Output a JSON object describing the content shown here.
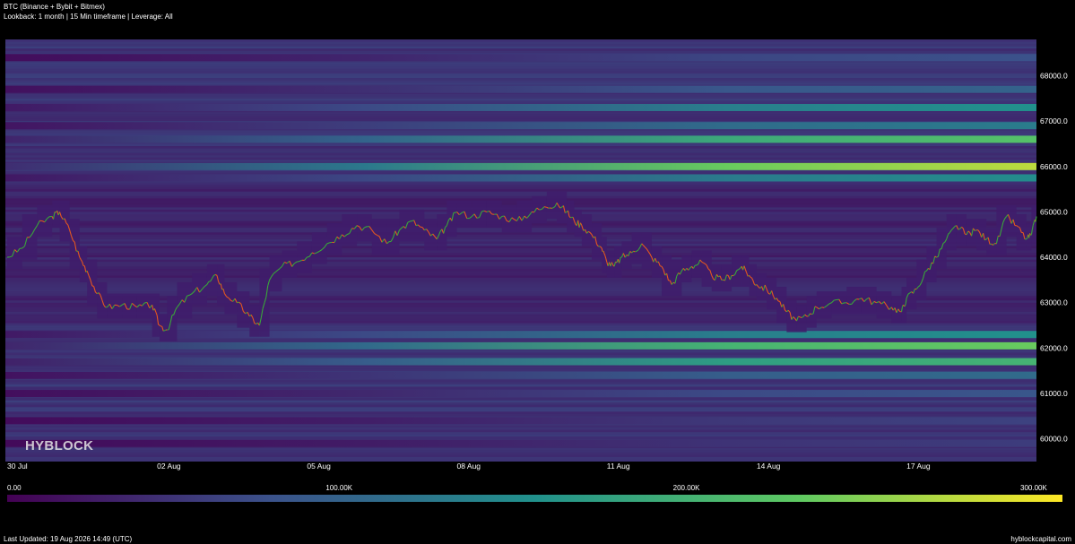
{
  "header": {
    "title": "BTC (Binance + Bybit + Bitmex)",
    "subtitle": "Lookback: 1 month | 15 Min timeframe | Leverage: All"
  },
  "watermark": "HYBLOCK",
  "footer": {
    "last_updated": "Last Updated: 19 Aug 2026 14:49 (UTC)",
    "site": "hyblockcapital.com"
  },
  "colors": {
    "background": "#000000",
    "price_up": "#3aa63a",
    "price_down": "#e4571f",
    "colormap": [
      "#440154",
      "#3b528b",
      "#21918c",
      "#5ec962",
      "#fde725"
    ]
  },
  "chart_data": {
    "type": "heatmap",
    "overlay": "price_line",
    "title": "BTC (Binance + Bybit + Bitmex)",
    "xlabel": "",
    "ylabel": "",
    "ylim": [
      59500,
      68800
    ],
    "grid": false,
    "x_ticks": [
      {
        "label": "30 Jul",
        "day": 0
      },
      {
        "label": "02 Aug",
        "day": 3
      },
      {
        "label": "05 Aug",
        "day": 6
      },
      {
        "label": "08 Aug",
        "day": 9
      },
      {
        "label": "11 Aug",
        "day": 12
      },
      {
        "label": "14 Aug",
        "day": 15
      },
      {
        "label": "17 Aug",
        "day": 18
      }
    ],
    "x_range_days": [
      0,
      20.6
    ],
    "y_ticks": [
      "60000.0",
      "61000.0",
      "62000.0",
      "63000.0",
      "64000.0",
      "65000.0",
      "66000.0",
      "67000.0",
      "68000.0"
    ],
    "y_tick_values": [
      60000,
      61000,
      62000,
      63000,
      64000,
      65000,
      66000,
      67000,
      68000
    ],
    "colorbar": {
      "range": [
        0,
        300000
      ],
      "ticks": [
        {
          "label": "0.00",
          "value": 0
        },
        {
          "label": "100.00K",
          "value": 100000
        },
        {
          "label": "200.00K",
          "value": 200000
        },
        {
          "label": "300.00K",
          "value": 300000
        }
      ]
    },
    "liquidation_levels": [
      {
        "price": 66000,
        "value": 270000
      },
      {
        "price": 62050,
        "value": 230000
      },
      {
        "price": 61700,
        "value": 195000
      },
      {
        "price": 66600,
        "value": 215000
      },
      {
        "price": 67300,
        "value": 150000
      },
      {
        "price": 65750,
        "value": 145000
      },
      {
        "price": 62300,
        "value": 150000
      },
      {
        "price": 66900,
        "value": 125000
      },
      {
        "price": 67700,
        "value": 95000
      },
      {
        "price": 68400,
        "value": 75000
      },
      {
        "price": 61400,
        "value": 105000
      },
      {
        "price": 61000,
        "value": 80000
      },
      {
        "price": 60400,
        "value": 60000
      },
      {
        "price": 59900,
        "value": 55000
      }
    ],
    "price_series": {
      "x_days": [
        0,
        0.3,
        0.6,
        0.9,
        1.05,
        1.25,
        1.45,
        1.6,
        1.8,
        2.0,
        2.3,
        2.6,
        2.9,
        3.05,
        3.2,
        3.4,
        3.7,
        4.0,
        4.2,
        4.35,
        4.6,
        4.85,
        5.05,
        5.25,
        5.5,
        5.8,
        6.1,
        6.4,
        6.7,
        7.0,
        7.3,
        7.6,
        7.85,
        8.1,
        8.35,
        8.6,
        8.8,
        9.0,
        9.3,
        9.6,
        9.9,
        10.2,
        10.5,
        10.8,
        11.0,
        11.2,
        11.35,
        11.5,
        11.7,
        11.9,
        12.0,
        12.15,
        12.3,
        12.5,
        12.7,
        12.9,
        13.1,
        13.3,
        13.5,
        13.7,
        13.9,
        14.1,
        14.3,
        14.5,
        14.7,
        14.85,
        15.0,
        15.2,
        15.4,
        15.6,
        15.8,
        16.0,
        16.2,
        16.5,
        16.8,
        17.1,
        17.4,
        17.7,
        17.9,
        18.0,
        18.2,
        18.4,
        18.6,
        18.8,
        19.0,
        19.2,
        19.4,
        19.6,
        19.8,
        20.0,
        20.2,
        20.4,
        20.5,
        20.6
      ],
      "prices": [
        64000,
        64200,
        64700,
        64900,
        65000,
        64600,
        64000,
        63700,
        63200,
        62900,
        62950,
        62900,
        62950,
        62500,
        62400,
        62900,
        63200,
        63400,
        63600,
        63200,
        63000,
        62700,
        62500,
        63500,
        63800,
        63900,
        64100,
        64300,
        64500,
        64700,
        64600,
        64300,
        64600,
        64800,
        64600,
        64400,
        64700,
        65000,
        64900,
        65000,
        64900,
        64800,
        65000,
        65100,
        65200,
        65000,
        64800,
        64700,
        64500,
        64200,
        63900,
        63800,
        64000,
        64100,
        64300,
        64000,
        63800,
        63400,
        63700,
        63800,
        63900,
        63600,
        63500,
        63600,
        63800,
        63600,
        63400,
        63300,
        63100,
        62800,
        62600,
        62700,
        62900,
        63000,
        63000,
        63100,
        63000,
        62900,
        62800,
        63100,
        63300,
        63700,
        64000,
        64400,
        64700,
        64500,
        64600,
        64400,
        64300,
        64900,
        64700,
        64400,
        64500,
        64900,
        65300
      ]
    }
  }
}
